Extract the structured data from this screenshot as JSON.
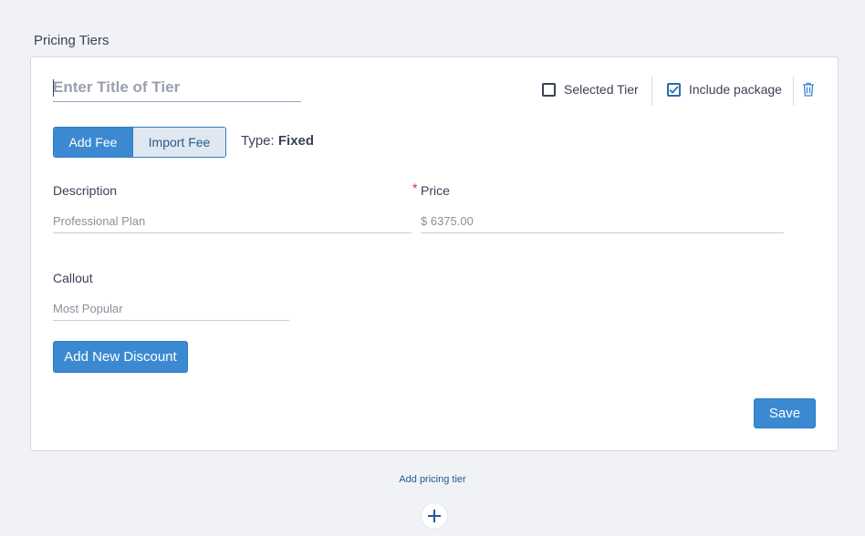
{
  "section": {
    "title": "Pricing Tiers"
  },
  "tier": {
    "title_value": "",
    "title_placeholder": "Enter Title of Tier",
    "selected_tier_label": "Selected Tier",
    "selected_tier_checked": false,
    "include_package_label": "Include package",
    "include_package_checked": true
  },
  "fee": {
    "add_fee_label": "Add Fee",
    "import_fee_label": "Import Fee",
    "type_prefix": "Type:",
    "type_value": "Fixed"
  },
  "fields": {
    "description_label": "Description",
    "description_placeholder": "Professional Plan",
    "price_label": "Price",
    "price_required_mark": "*",
    "price_placeholder": "$ 6375.00",
    "callout_label": "Callout",
    "callout_placeholder": "Most Popular"
  },
  "actions": {
    "add_discount_label": "Add New Discount",
    "save_label": "Save"
  },
  "footer": {
    "add_tier_label": "Add pricing tier"
  },
  "icons": {
    "trash": "trash-icon",
    "plus": "plus-icon",
    "check": "check-icon"
  },
  "colors": {
    "accent": "#3b8ad1",
    "accent_border": "#2d7dc2",
    "required": "#e0262b",
    "link": "#1e5a96"
  }
}
